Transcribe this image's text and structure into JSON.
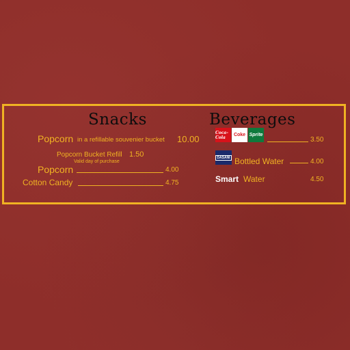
{
  "snacks": {
    "heading": "Snacks",
    "item1_name": "Popcorn",
    "item1_desc": "in a refillable souvenier bucket",
    "item1_price": "10.00",
    "refill_name": "Popcorn Bucket Refill",
    "refill_price": "1.50",
    "refill_note": "Valid day of purchase",
    "item2_name": "Popcorn",
    "item2_price": "4.00",
    "item3_name": "Cotton Candy",
    "item3_price": "4.75"
  },
  "beverages": {
    "heading": "Beverages",
    "soda_price": "3.50",
    "soda_logos": [
      "Coca-Cola",
      "Coke",
      "Sprite"
    ],
    "water_logo": "DASANI",
    "water_name": "Bottled Water",
    "water_price": "4.00",
    "smart_brand": "Smart",
    "smart_name": "Water",
    "smart_price": "4.50"
  },
  "colors": {
    "background": "#8e2e2a",
    "accent": "#f0b323",
    "heading": "#0d0d0d"
  }
}
